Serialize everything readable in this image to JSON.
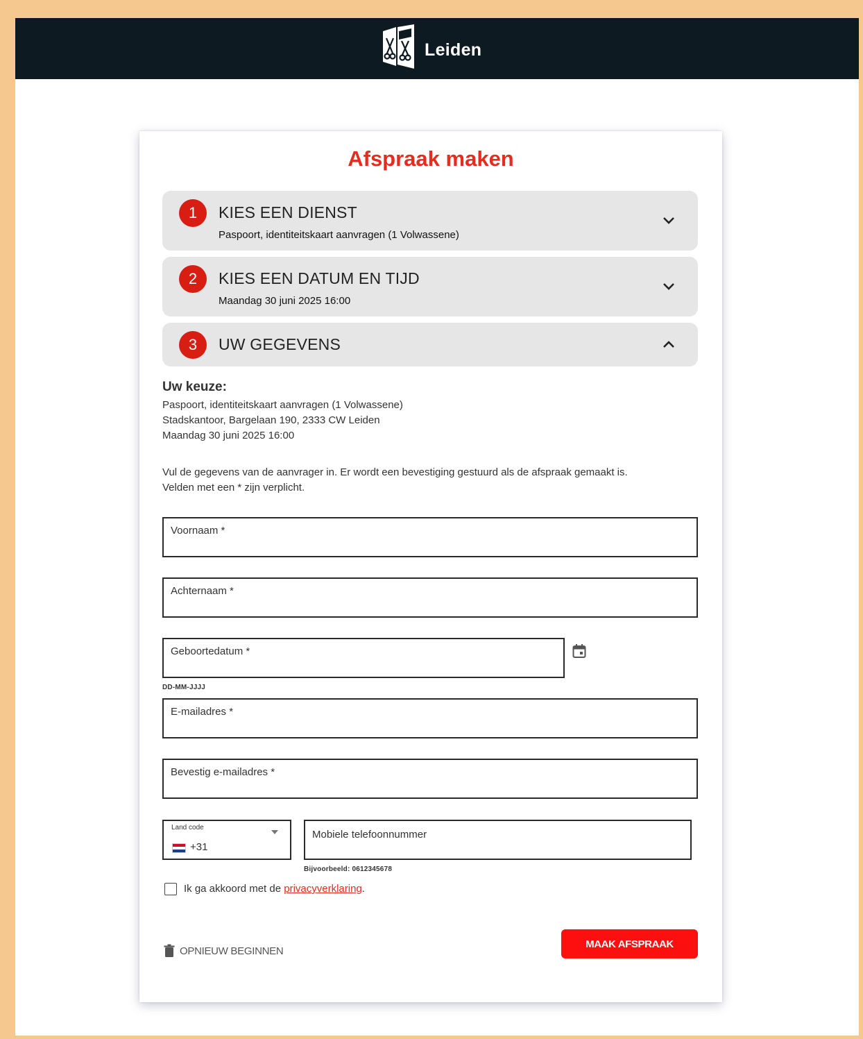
{
  "header": {
    "brand": "Leiden"
  },
  "page_title": "Afspraak maken",
  "steps": [
    {
      "number": "1",
      "title": "KIES EEN DIENST",
      "summary": "Paspoort, identiteitskaart aanvragen (1 Volwassene)",
      "expanded": false
    },
    {
      "number": "2",
      "title": "KIES EEN DATUM EN TIJD",
      "summary": "Maandag 30 juni 2025 16:00",
      "expanded": false
    },
    {
      "number": "3",
      "title": "UW GEGEVENS",
      "summary": "",
      "expanded": true
    }
  ],
  "keuze": {
    "title": "Uw keuze:",
    "lines": [
      "Paspoort, identiteitskaart aanvragen (1 Volwassene)",
      "Stadskantoor, Bargelaan 190, 2333 CW Leiden",
      "Maandag 30 juni 2025 16:00"
    ]
  },
  "instructions": [
    "Vul de gegevens van de aanvrager in. Er wordt een bevestiging gestuurd als de afspraak gemaakt is.",
    "Velden met een * zijn verplicht."
  ],
  "form": {
    "voornaam_label": "Voornaam *",
    "achternaam_label": "Achternaam *",
    "geboortedatum_label": "Geboortedatum *",
    "geboortedatum_hint": "DD-MM-JJJJ",
    "email_label": "E-mailadres *",
    "email_confirm_label": "Bevestig e-mailadres *",
    "country_code_label": "Land code",
    "country_code_value": "+31",
    "phone_label": "Mobiele telefoonnummer",
    "phone_hint": "Bijvoorbeeld: 0612345678",
    "agree_prefix": "Ik ga akkoord met de ",
    "agree_link": "privacyverklaring",
    "agree_suffix": "."
  },
  "actions": {
    "restart_label": "OPNIEUW BEGINNEN",
    "submit_label": "MAAK AFSPRAAK"
  },
  "colors": {
    "topbar": "#0e1a22",
    "accent_red": "#e52c1f",
    "step_bg": "#e6e6e6",
    "submit_bg": "#fb0f0f",
    "outer_border": "#f5c890"
  },
  "icons": {
    "logo": "leiden-keys-logo",
    "collapsed": "chevron-down-icon",
    "expanded": "chevron-up-icon",
    "calendar": "calendar-icon",
    "restart": "trash-icon",
    "flag": "netherlands-flag-icon"
  }
}
